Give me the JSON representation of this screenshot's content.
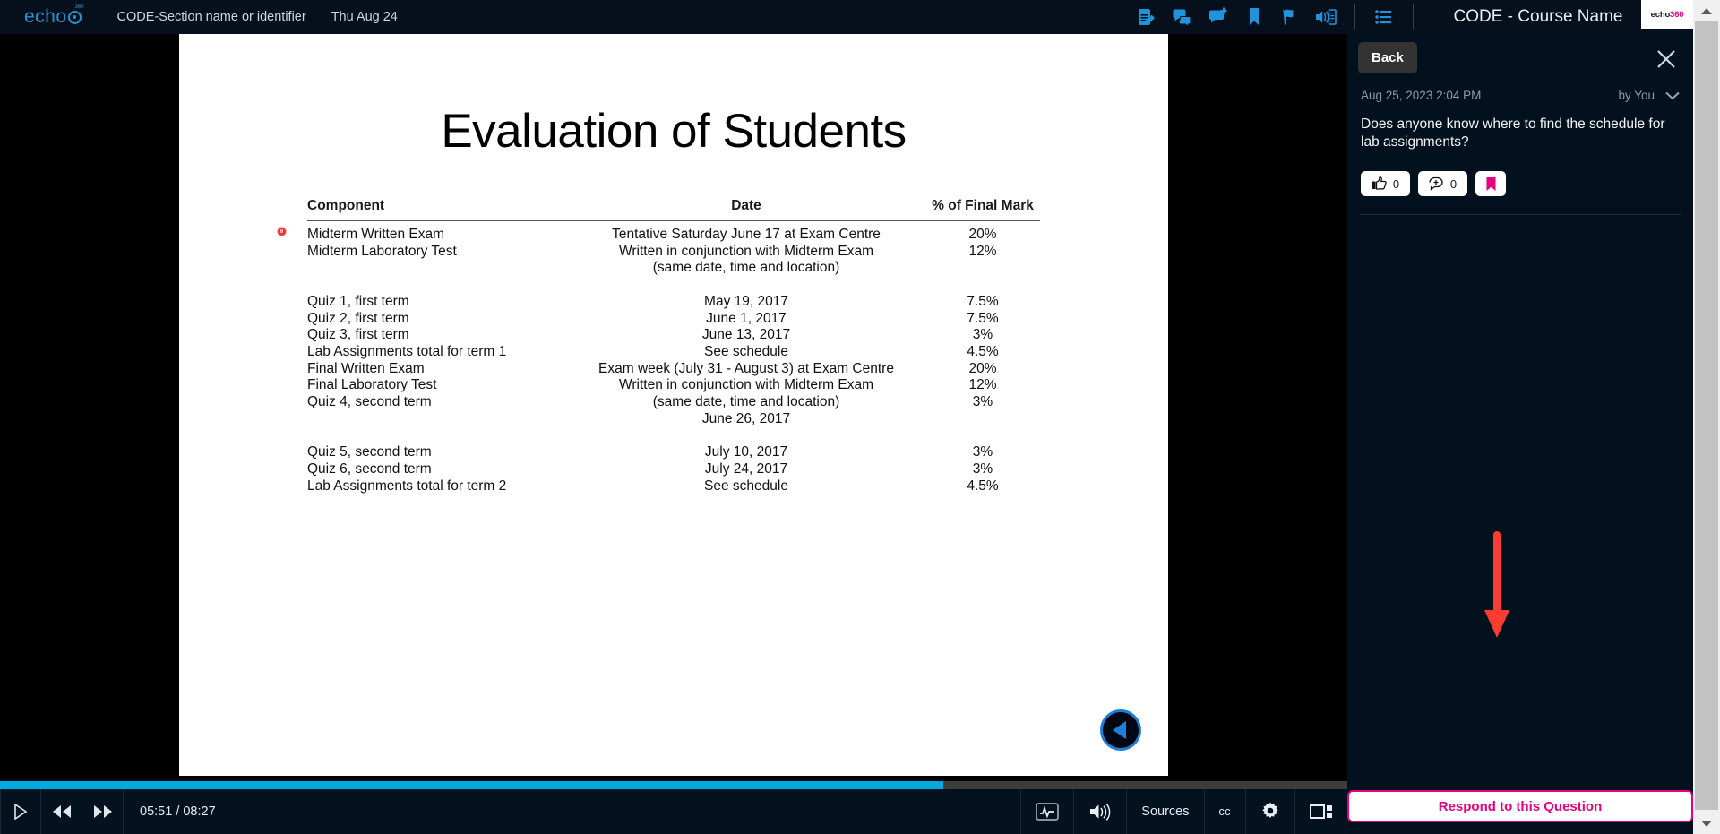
{
  "topbar": {
    "logo_text": "echo",
    "logo_sup": "360",
    "section": "CODE-Section name or identifier",
    "date": "Thu Aug 24",
    "course_title": "CODE - Course Name",
    "brand_box_black": "echo",
    "brand_box_pink": "360",
    "icons": [
      {
        "name": "notes-icon",
        "label": "Notes"
      },
      {
        "name": "discussions-icon",
        "label": "Discussions"
      },
      {
        "name": "ask-question-icon",
        "label": "Ask a Question"
      },
      {
        "name": "bookmark-icon",
        "label": "Bookmarks"
      },
      {
        "name": "flag-icon",
        "label": "Flag Confusion"
      },
      {
        "name": "transcript-audio-icon",
        "label": "Audio Transcript"
      },
      {
        "name": "list-icon",
        "label": "Class List"
      }
    ]
  },
  "slide": {
    "title": "Evaluation of Students",
    "table": {
      "headers": [
        "Component",
        "Date",
        "% of Final Mark"
      ],
      "rows": [
        {
          "component": "Midterm Written Exam",
          "date": "Tentative Saturday June 17 at Exam Centre",
          "pct": "20%"
        },
        {
          "component": "Midterm Laboratory Test",
          "date": "Written in conjunction with Midterm Exam",
          "pct": "12%"
        },
        {
          "component": "",
          "date": "(same date, time and location)",
          "pct": ""
        },
        {
          "component": "",
          "date": "",
          "pct": ""
        },
        {
          "component": "Quiz 1, first term",
          "date": "May 19, 2017",
          "pct": "7.5%"
        },
        {
          "component": "Quiz 2, first term",
          "date": "June 1, 2017",
          "pct": "7.5%"
        },
        {
          "component": "Quiz 3, first term",
          "date": "June 13, 2017",
          "pct": "3%"
        },
        {
          "component": "Lab Assignments total for term 1",
          "date": "See schedule",
          "pct": "4.5%"
        },
        {
          "component": "Final Written Exam",
          "date": "Exam week (July 31 - August 3) at Exam Centre",
          "pct": "20%"
        },
        {
          "component": "Final Laboratory Test",
          "date": "Written in conjunction with Midterm Exam",
          "pct": "12%"
        },
        {
          "component": "Quiz 4, second term",
          "date": "(same date, time and location)",
          "pct": "3%"
        },
        {
          "component": "",
          "date": "June 26, 2017",
          "pct": ""
        },
        {
          "component": "",
          "date": "",
          "pct": ""
        },
        {
          "component": "Quiz 5, second term",
          "date": "July 10, 2017",
          "pct": "3%"
        },
        {
          "component": "Quiz 6, second term",
          "date": "July 24, 2017",
          "pct": "3%"
        },
        {
          "component": "Lab Assignments total for term 2",
          "date": "See schedule",
          "pct": "4.5%"
        }
      ]
    },
    "marker_label": "0"
  },
  "qa": {
    "back_label": "Back",
    "timestamp": "Aug 25, 2023 2:04 PM",
    "author": "by You",
    "question": "Does anyone know where to find the schedule for lab assignments?",
    "like_count": "0",
    "reply_count": "0",
    "respond_label": "Respond to this Question"
  },
  "player": {
    "current_time": "05:51",
    "total_time": "08:27",
    "time_display": "05:51 / 08:27",
    "progress_percent": 70,
    "sources_label": "Sources",
    "cc_label": "cc"
  },
  "colors": {
    "accent_blue": "#00a9e0",
    "brand_pink": "#e6007e",
    "icon_blue": "#2196d6",
    "panel_bg": "#03111f",
    "annotation_red": "#fa3c32"
  }
}
